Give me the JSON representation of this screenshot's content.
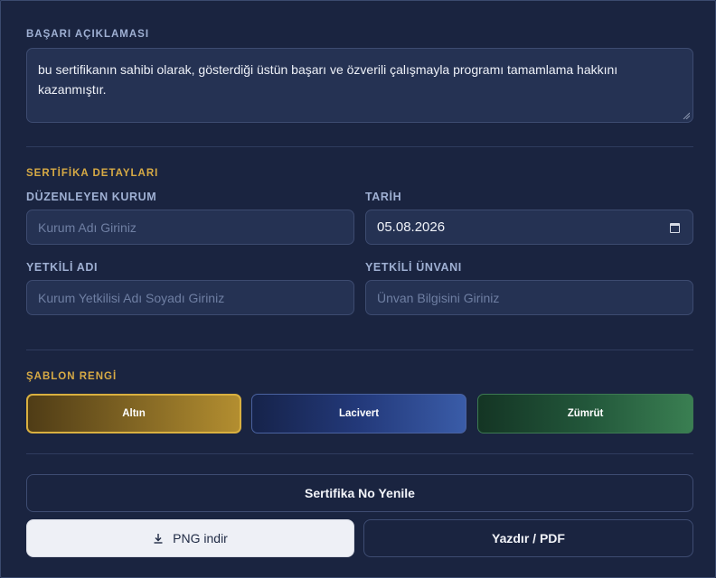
{
  "achievement": {
    "section_label": "BAŞARI AÇIKLAMASI",
    "text_line1": "bu sertifikanın sahibi olarak, gösterdiği üstün başarı ve özverili çalışmayla programı tamamlama hakkını",
    "text_line2": "kazanmıştır."
  },
  "details": {
    "section_label": "SERTİFİKA DETAYLARI",
    "org_label": "DÜZENLEYEN KURUM",
    "org_placeholder": "Kurum Adı Giriniz",
    "date_label": "TARİH",
    "date_value": "05.08.2026",
    "auth_name_label": "YETKİLİ ADI",
    "auth_name_placeholder": "Kurum Yetkilisi Adı Soyadı Giriniz",
    "auth_title_label": "YETKİLİ ÜNVANI",
    "auth_title_placeholder": "Ünvan Bilgisini Giriniz"
  },
  "template": {
    "section_label": "ŞABLON RENGİ",
    "options": [
      "Altın",
      "Lacivert",
      "Zümrüt"
    ],
    "selected": "Altın",
    "colors": {
      "gold": "#b38e30",
      "navy": "#23397a",
      "emerald": "#22563a"
    }
  },
  "actions": {
    "renew_label": "Sertifika No Yenile",
    "png_label": "PNG indir",
    "print_label": "Yazdır / PDF",
    "png_icon": "download-icon"
  },
  "theme": {
    "accent": "#d7aa45",
    "background": "#1a2440"
  }
}
